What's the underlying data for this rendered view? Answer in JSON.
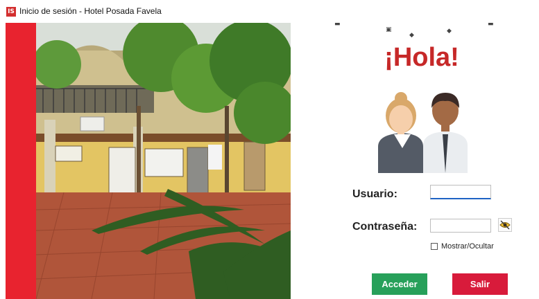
{
  "window": {
    "icon_text": "IS",
    "title": "Inicio de sesión  -  Hotel Posada Favela"
  },
  "greeting": "¡Hola!",
  "form": {
    "user_label": "Usuario:",
    "user_value": "",
    "password_label": "Contraseña:",
    "password_value": "",
    "show_hide_label": "Mostrar/Ocultar",
    "show_hide_checked": false
  },
  "buttons": {
    "login": "Acceder",
    "exit": "Salir"
  },
  "colors": {
    "accent_red": "#e8232f",
    "greeting_red": "#c62828",
    "login_green": "#27a05a",
    "exit_red": "#d81b3b",
    "focus_blue": "#1e63c4"
  },
  "icons": [
    "app-logo-icon",
    "eye-toggle-icon",
    "users-avatar-icon"
  ]
}
